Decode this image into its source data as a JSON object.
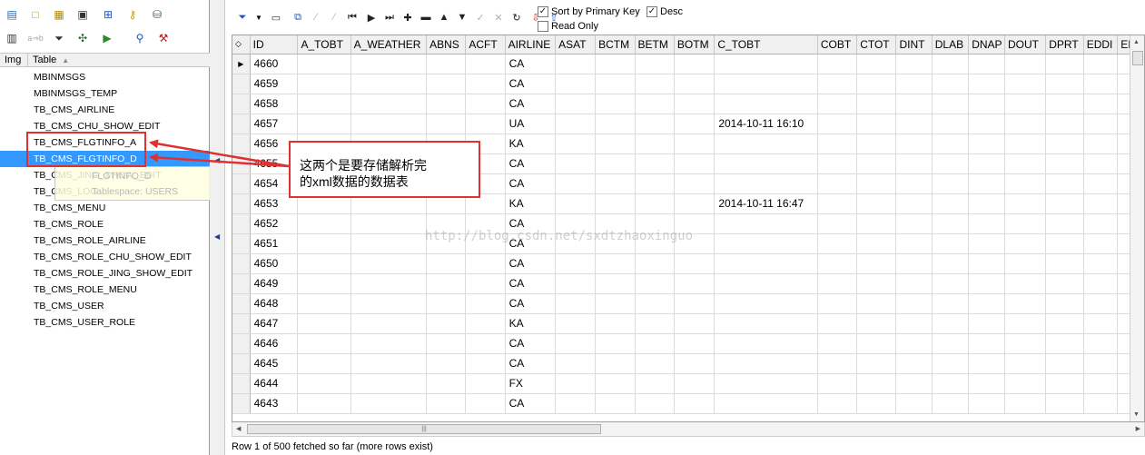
{
  "left_toolbar": {
    "row1_icons": [
      "sql-window-icon",
      "new-icon",
      "browse-icon",
      "properties-icon",
      "tree-icon",
      "key-icon",
      "database-icon"
    ],
    "row2_icons": [
      "calculator-icon",
      "replace-icon",
      "filter-icon",
      "tools-icon",
      "run-icon",
      "find-icon",
      "hammer-icon"
    ],
    "replace_label": "a⇒b"
  },
  "tree": {
    "col_img": "Img",
    "col_table": "Table",
    "items": [
      {
        "label": "MBINMSGS"
      },
      {
        "label": "MBINMSGS_TEMP"
      },
      {
        "label": "TB_CMS_AIRLINE"
      },
      {
        "label": "TB_CMS_CHU_SHOW_EDIT"
      },
      {
        "label": "TB_CMS_FLGTINFO_A"
      },
      {
        "label": "TB_CMS_FLGTINFO_D"
      },
      {
        "label": "TB_CMS_JING_SHOW_EDIT"
      },
      {
        "label": "TB_CMS_LOG"
      },
      {
        "label": "TB_CMS_MENU"
      },
      {
        "label": "TB_CMS_ROLE"
      },
      {
        "label": "TB_CMS_ROLE_AIRLINE"
      },
      {
        "label": "TB_CMS_ROLE_CHU_SHOW_EDIT"
      },
      {
        "label": "TB_CMS_ROLE_JING_SHOW_EDIT"
      },
      {
        "label": "TB_CMS_ROLE_MENU"
      },
      {
        "label": "TB_CMS_USER"
      },
      {
        "label": "TB_CMS_USER_ROLE"
      }
    ],
    "selected_index": 5,
    "tooltip_line1": "FLGTINFO_D",
    "tooltip_line2": "Tablespace: USERS"
  },
  "data_toolbar": {
    "sort_by_pk_label": "Sort by Primary Key",
    "sort_by_pk_checked": true,
    "desc_label": "Desc",
    "desc_checked": true,
    "read_only_label": "Read Only",
    "read_only_checked": false
  },
  "grid": {
    "columns": [
      "ID",
      "A_TOBT",
      "A_WEATHER",
      "ABNS",
      "ACFT",
      "AIRLINE",
      "ASAT",
      "BCTM",
      "BETM",
      "BOTM",
      "C_TOBT",
      "COBT",
      "CTOT",
      "DINT",
      "DLAB",
      "DNAP",
      "DOUT",
      "DPRT",
      "EDDI",
      "EI"
    ],
    "rows": [
      {
        "id": "4660",
        "airline": "CA",
        "c_tobt": ""
      },
      {
        "id": "4659",
        "airline": "CA",
        "c_tobt": ""
      },
      {
        "id": "4658",
        "airline": "CA",
        "c_tobt": ""
      },
      {
        "id": "4657",
        "airline": "UA",
        "c_tobt": "2014-10-11 16:10"
      },
      {
        "id": "4656",
        "airline": "KA",
        "c_tobt": ""
      },
      {
        "id": "4655",
        "airline": "CA",
        "c_tobt": ""
      },
      {
        "id": "4654",
        "airline": "CA",
        "c_tobt": ""
      },
      {
        "id": "4653",
        "airline": "KA",
        "c_tobt": "2014-10-11 16:47"
      },
      {
        "id": "4652",
        "airline": "CA",
        "c_tobt": ""
      },
      {
        "id": "4651",
        "airline": "CA",
        "c_tobt": ""
      },
      {
        "id": "4650",
        "airline": "CA",
        "c_tobt": ""
      },
      {
        "id": "4649",
        "airline": "CA",
        "c_tobt": ""
      },
      {
        "id": "4648",
        "airline": "CA",
        "c_tobt": ""
      },
      {
        "id": "4647",
        "airline": "KA",
        "c_tobt": ""
      },
      {
        "id": "4646",
        "airline": "CA",
        "c_tobt": ""
      },
      {
        "id": "4645",
        "airline": "CA",
        "c_tobt": ""
      },
      {
        "id": "4644",
        "airline": "FX",
        "c_tobt": ""
      },
      {
        "id": "4643",
        "airline": "CA",
        "c_tobt": ""
      }
    ],
    "current_row_marker": "▶"
  },
  "status_text": "Row 1 of 500 fetched so far (more rows exist)",
  "annotation": {
    "line1": "这两个是要存储解析完",
    "line2": "的xml数据的数据表",
    "color": "#e03030"
  },
  "watermark": "http://blog.csdn.net/sxdtzhaoxinguo"
}
